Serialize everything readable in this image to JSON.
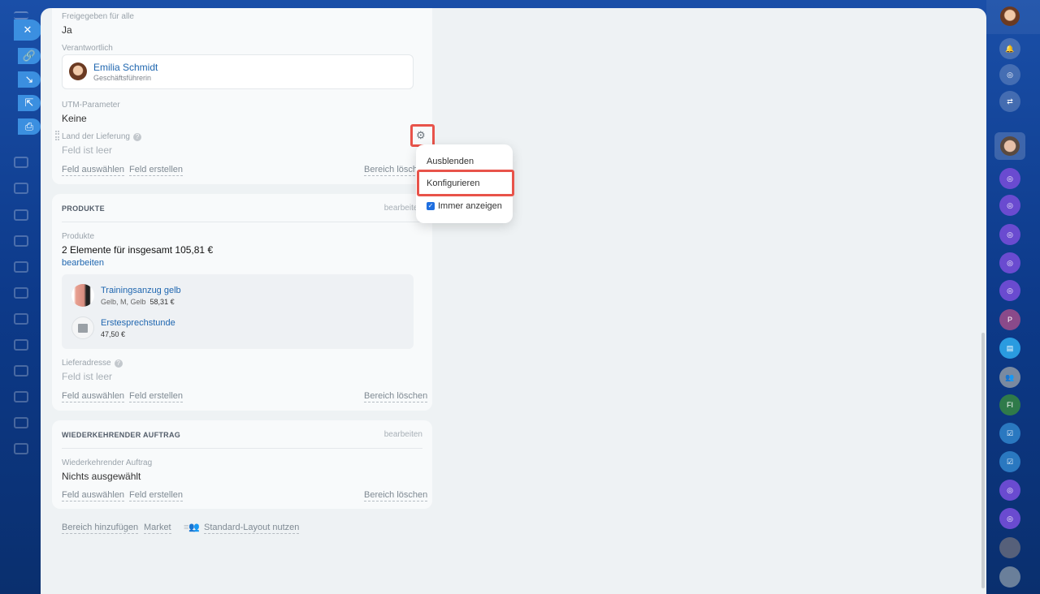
{
  "card_general": {
    "shared_label": "Freigegeben für alle",
    "shared_value": "Ja",
    "responsible_label": "Verantwortlich",
    "responsible_name": "Emilia Schmidt",
    "responsible_role": "Geschäftsführerin",
    "utm_label": "UTM-Parameter",
    "utm_value": "Keine",
    "country_label": "Land der Lieferung",
    "country_value": "Feld ist leer",
    "select_field": "Feld auswählen",
    "create_field": "Feld erstellen",
    "delete_section": "Bereich löschen"
  },
  "card_products": {
    "title": "PRODUKTE",
    "edit": "bearbeiten",
    "products_label": "Produkte",
    "summary": "2 Elemente für insgesamt 105,81 €",
    "edit_link": "bearbeiten",
    "items": [
      {
        "name": "Trainingsanzug gelb",
        "props": "Gelb, M, Gelb",
        "price": "58,31 €"
      },
      {
        "name": "Erstesprechstunde",
        "props": "",
        "price": "47,50 €"
      }
    ],
    "address_label": "Lieferadresse",
    "address_value": "Feld ist leer",
    "select_field": "Feld auswählen",
    "create_field": "Feld erstellen",
    "delete_section": "Bereich löschen"
  },
  "card_recurring": {
    "title": "WIEDERKEHRENDER AUFTRAG",
    "edit": "bearbeiten",
    "label": "Wiederkehrender Auftrag",
    "value": "Nichts ausgewählt",
    "select_field": "Feld auswählen",
    "create_field": "Feld erstellen",
    "delete_section": "Bereich löschen"
  },
  "footer": {
    "add_section": "Bereich hinzufügen",
    "market": "Market",
    "default_layout": "Standard-Layout nutzen"
  },
  "context_menu": {
    "hide": "Ausblenden",
    "configure": "Konfigurieren",
    "always_show": "Immer anzeigen",
    "always_show_checked": true
  },
  "right_bar": {
    "p_initial": "P",
    "fi_initials": "FI"
  },
  "colors": {
    "highlight": "#e8534a",
    "accent": "#2067b0"
  }
}
